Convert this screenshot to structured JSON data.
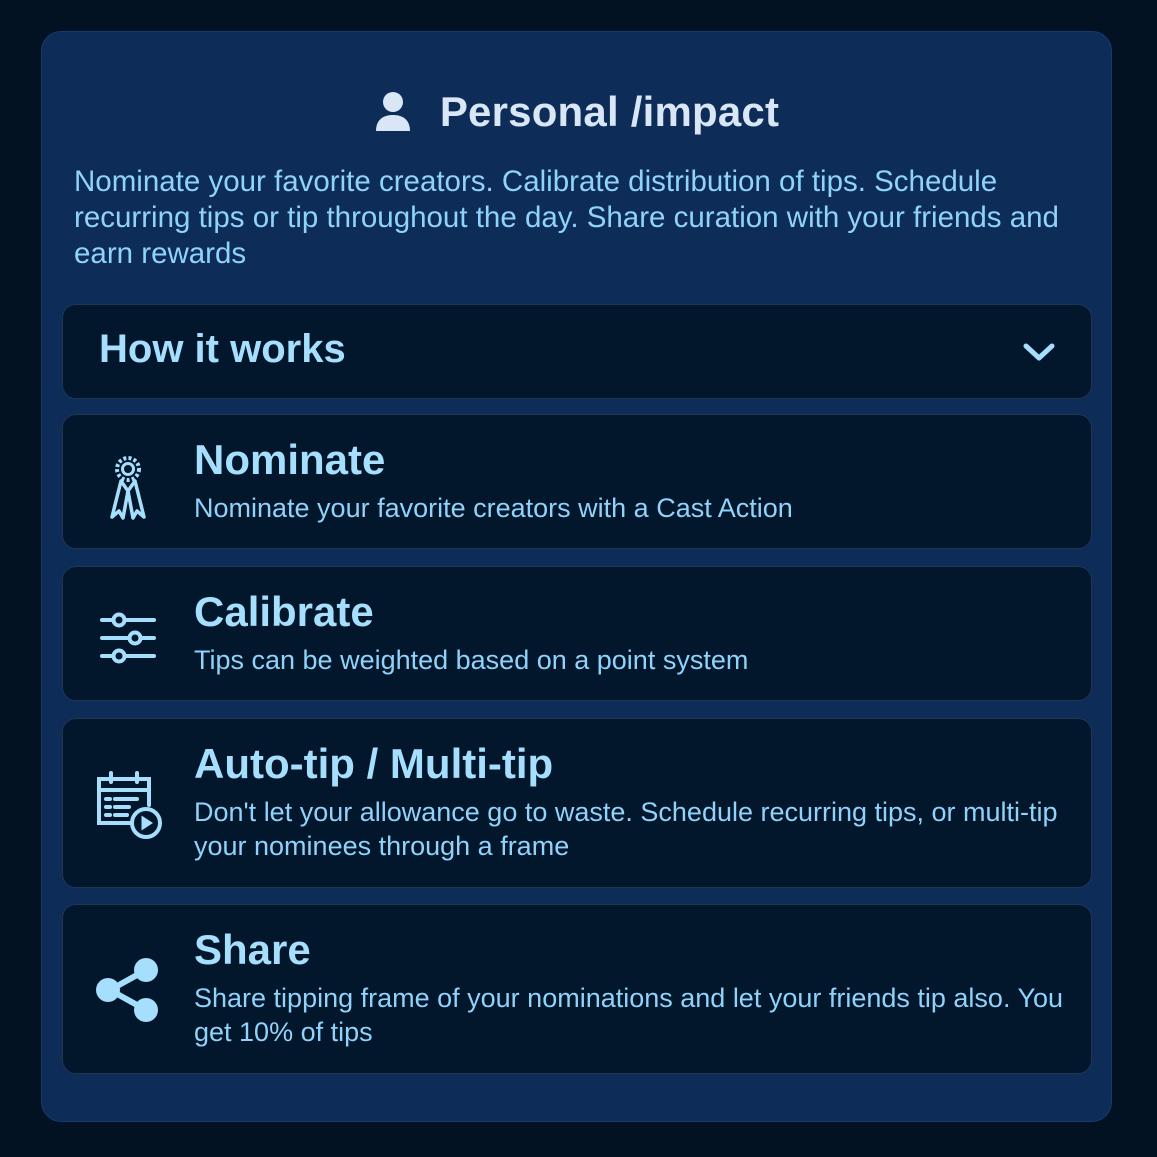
{
  "header": {
    "icon": "person-icon",
    "title": "Personal /impact"
  },
  "intro": "Nominate your favorite creators. Calibrate distribution of tips. Schedule recurring tips or tip throughout the day. Share curation with your friends and earn rewards",
  "accordion": {
    "title": "How it works",
    "icon": "chevron-down-icon",
    "expanded": true
  },
  "features": [
    {
      "icon": "award-ribbon-icon",
      "title": "Nominate",
      "description": "Nominate your favorite creators with a Cast Action"
    },
    {
      "icon": "sliders-icon",
      "title": "Calibrate",
      "description": "Tips can be weighted based on a point system"
    },
    {
      "icon": "calendar-schedule-icon",
      "title": "Auto-tip / Multi-tip",
      "description": "Don't let your allowance go to waste. Schedule recurring tips, or multi-tip your nominees through a frame"
    },
    {
      "icon": "share-icon",
      "title": "Share",
      "description": "Share tipping frame of your nominations and let your friends tip also. You get 10% of tips"
    }
  ],
  "colors": {
    "page_background": "#031222",
    "panel_background": "#0e2c58",
    "card_background": "#02162c",
    "heading_text": "#d9e6f5",
    "accent_text": "#a6defd",
    "body_text": "#8fd3fb"
  }
}
